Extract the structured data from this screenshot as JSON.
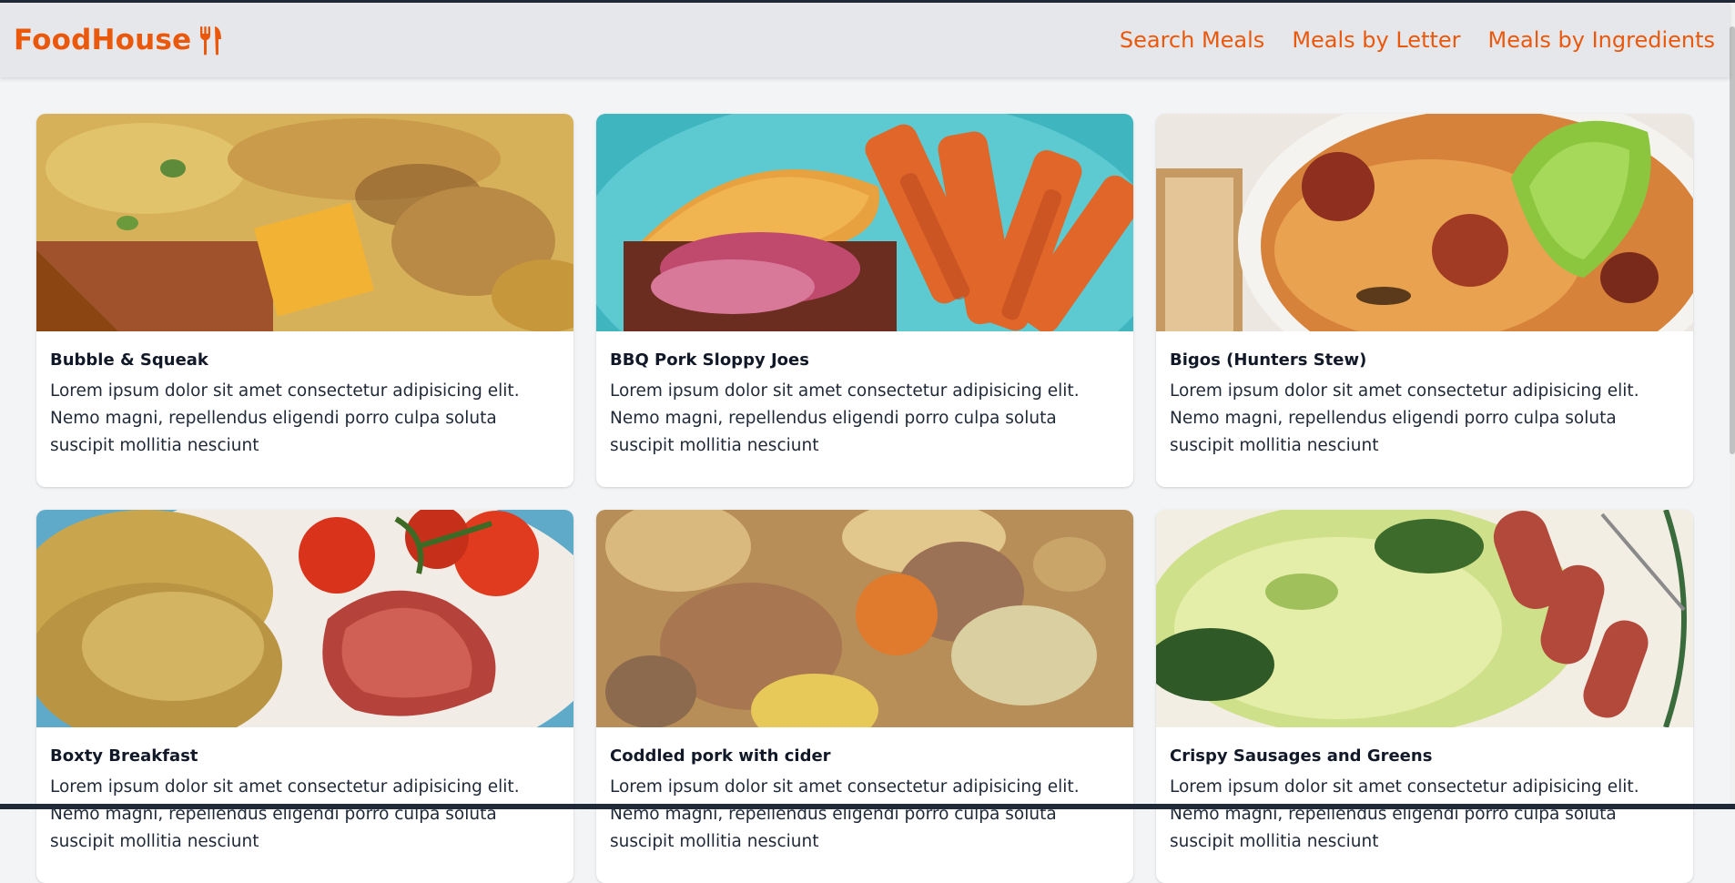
{
  "nav": {
    "brand": "FoodHouse",
    "brand_icon": "fork-knife-icon",
    "links": [
      "Search Meals",
      "Meals by Letter",
      "Meals by Ingredients"
    ],
    "accent_color": "#ea580c"
  },
  "meals": [
    {
      "title": "Bubble & Squeak",
      "description": "Lorem ipsum dolor sit amet consectetur adipisicing elit. Nemo magni, repellendus eligendi porro culpa soluta suscipit mollitia nesciunt",
      "image_alt": "baked omelette slice photo"
    },
    {
      "title": "BBQ Pork Sloppy Joes",
      "description": "Lorem ipsum dolor sit amet consectetur adipisicing elit. Nemo magni, repellendus eligendi porro culpa soluta suscipit mollitia nesciunt",
      "image_alt": "sloppy joe sandwich with fries photo"
    },
    {
      "title": "Bigos (Hunters Stew)",
      "description": "Lorem ipsum dolor sit amet consectetur adipisicing elit. Nemo magni, repellendus eligendi porro culpa soluta suscipit mollitia nesciunt",
      "image_alt": "sauerkraut stew with sausage photo"
    },
    {
      "title": "Boxty Breakfast",
      "description": "Lorem ipsum dolor sit amet consectetur adipisicing elit. Nemo magni, repellendus eligendi porro culpa soluta suscipit mollitia nesciunt",
      "image_alt": "potato pancakes with bacon and tomatoes photo"
    },
    {
      "title": "Coddled pork with cider",
      "description": "Lorem ipsum dolor sit amet consectetur adipisicing elit. Nemo magni, repellendus eligendi porro culpa soluta suscipit mollitia nesciunt",
      "image_alt": "pork and vegetable stew photo"
    },
    {
      "title": "Crispy Sausages and Greens",
      "description": "Lorem ipsum dolor sit amet consectetur adipisicing elit. Nemo magni, repellendus eligendi porro culpa soluta suscipit mollitia nesciunt",
      "image_alt": "sausages with cabbage greens photo"
    }
  ]
}
